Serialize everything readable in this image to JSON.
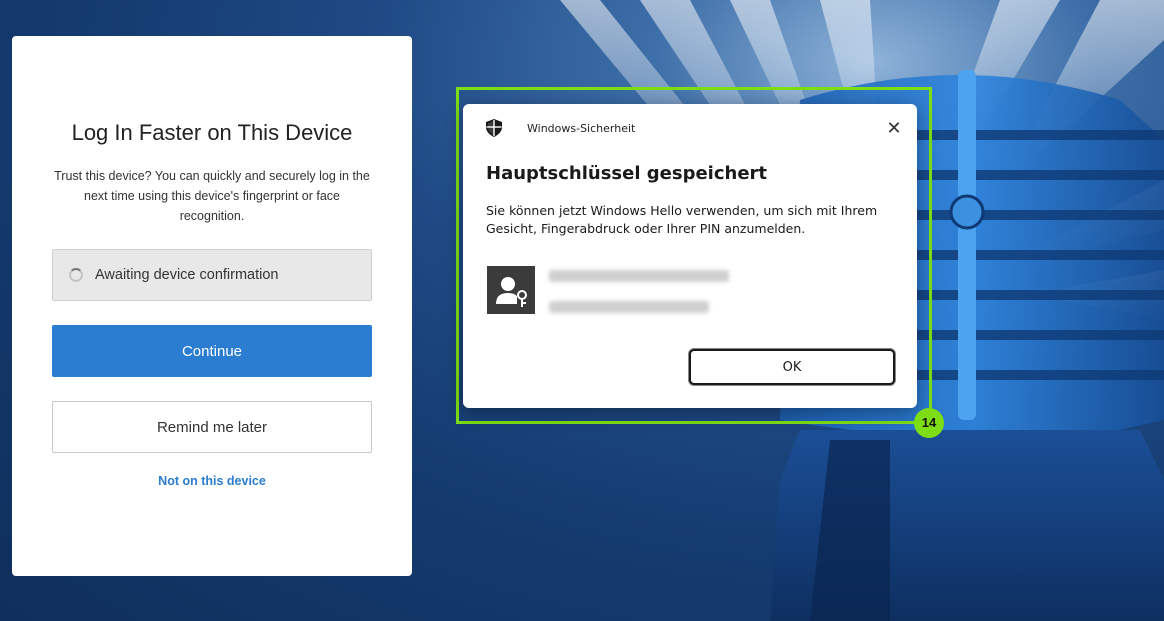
{
  "login_card": {
    "title": "Log In Faster on This Device",
    "description": "Trust this device? You can quickly and securely log in the next time using this device's fingerprint or face recognition.",
    "status_text": "Awaiting device confirmation",
    "continue_label": "Continue",
    "remind_label": "Remind me later",
    "not_device_label": "Not on this device"
  },
  "dialog": {
    "app_name": "Windows-Sicherheit",
    "close_glyph": "✕",
    "title": "Hauptschlüssel gespeichert",
    "message": "Sie können jetzt Windows Hello verwenden, um sich mit Ihrem Gesicht, Fingerabdruck oder Ihrer PIN anzumelden.",
    "ok_label": "OK",
    "icons": [
      "shield-icon",
      "user-key-icon"
    ]
  },
  "annotation": {
    "badge_number": "14",
    "highlight_color": "#7dde16"
  },
  "colors": {
    "primary_button": "#2a7dd0",
    "link": "#2a7dd0",
    "background": "#143a6e"
  }
}
